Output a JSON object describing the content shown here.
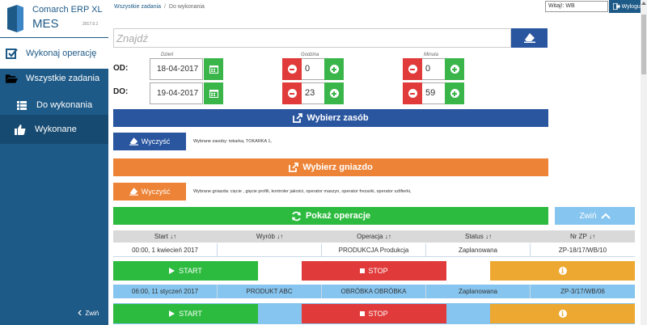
{
  "app": {
    "brand": "Comarch ERP XL",
    "product": "MES",
    "version": "2017.0.1"
  },
  "sidebar": {
    "items": [
      {
        "label": "Wykonaj operację",
        "icon": "checkbox-icon"
      },
      {
        "label": "Wszystkie zadania",
        "icon": "folder-open-icon"
      },
      {
        "label": "Do wykonania",
        "icon": "list-icon"
      },
      {
        "label": "Wykonane",
        "icon": "thumbs-up-icon"
      }
    ],
    "collapse_label": "Zwiń"
  },
  "breadcrumb": {
    "root": "Wszystkie zadania",
    "separator": "/",
    "current": "Do wykonania"
  },
  "header": {
    "user_value": "Witaj!: WB",
    "logout_label": "Wyloguj"
  },
  "search": {
    "placeholder": "Znajdź"
  },
  "time": {
    "labels": {
      "day": "Dzień",
      "hour": "Godzina",
      "minute": "Minuta"
    },
    "from": {
      "label": "OD:",
      "date": "18-04-2017",
      "hour": "0",
      "minute": "0"
    },
    "to": {
      "label": "DO:",
      "date": "19-04-2017",
      "hour": "23",
      "minute": "59"
    }
  },
  "resource": {
    "select_label": "Wybierz zasób",
    "clear_label": "Wyczyść",
    "selected_text": "Wybrane zasoby: tokarka, TOKARKA 1,"
  },
  "workstation": {
    "select_label": "Wybierz gniazdo",
    "clear_label": "Wyczyść",
    "selected_text": "Wybrane gniazda: cięcie , gięcie profili, kontroler jakości, operator maszyn, operator frezarki, operator szlifierki,"
  },
  "show_label": "Pokaż operacje",
  "collapse_filters_label": "Zwiń",
  "table": {
    "columns": [
      "Start",
      "Wyrób",
      "Operacja",
      "Status",
      "Nr ZP"
    ],
    "sort_glyph": "↓↑",
    "rows": [
      {
        "start": "00:00, 1 kwiecień 2017",
        "product": "",
        "operation": "PRODUKCJA Produkcja",
        "status": "Zaplanowana",
        "order": "ZP-18/17/WB/10"
      },
      {
        "start": "06:00, 11 styczeń 2017",
        "product": "PRODUKT ABC",
        "operation": "OBRÓBKA OBRÓBKA",
        "status": "Zaplanowana",
        "order": "ZP-3/17/WB/06"
      }
    ],
    "start_label": "START",
    "stop_label": "STOP"
  },
  "colors": {
    "sidebar": "#1e5a87",
    "blue": "#2a56a0",
    "orange": "#ed8336",
    "green": "#2dbb3f",
    "red": "#e03a3a",
    "amber": "#eda832",
    "light_blue": "#86c5ef"
  }
}
